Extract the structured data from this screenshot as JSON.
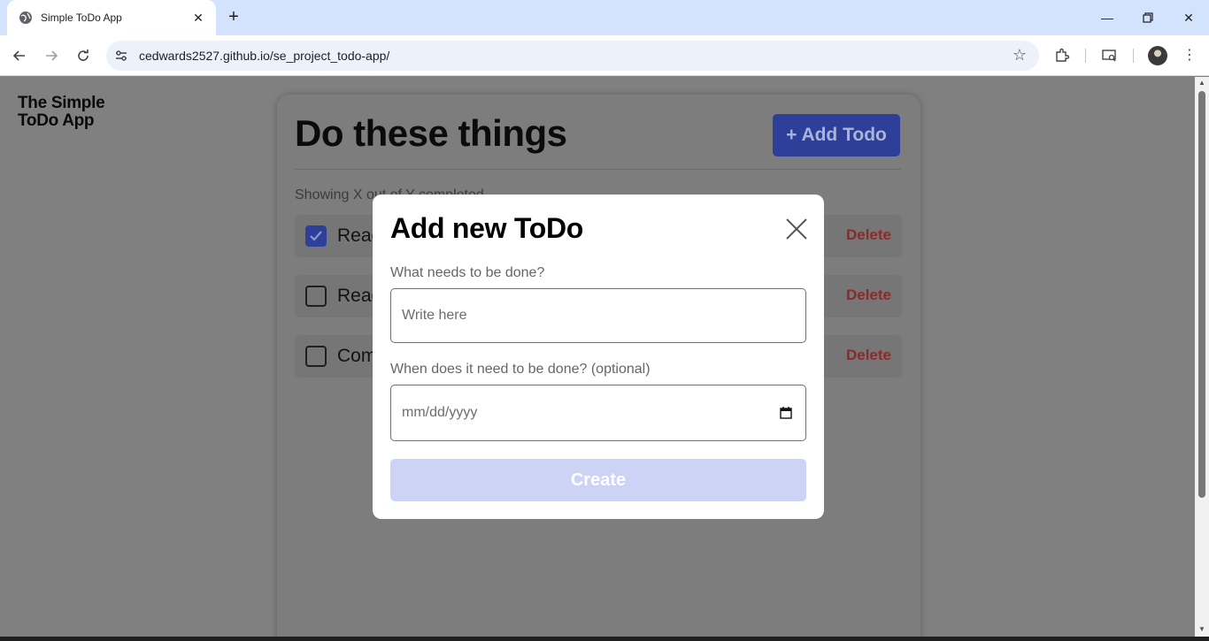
{
  "browser": {
    "tab_title": "Simple ToDo App",
    "url": "cedwards2527.github.io/se_project_todo-app/"
  },
  "page": {
    "brand": "The Simple ToDo App",
    "title": "Do these things",
    "add_button": "+ Add Todo",
    "summary": "Showing X out of Y completed",
    "todos": [
      {
        "text": "Read",
        "checked": true,
        "delete_label": "Delete"
      },
      {
        "text": "Read",
        "checked": false,
        "delete_label": "Delete"
      },
      {
        "text": "Com",
        "checked": false,
        "delete_label": "Delete"
      }
    ]
  },
  "modal": {
    "title": "Add new ToDo",
    "name_label": "What needs to be done?",
    "name_placeholder": "Write here",
    "date_label": "When does it need to be done? (optional)",
    "date_placeholder": "mm/dd/yyyy",
    "submit_label": "Create"
  },
  "colors": {
    "primary": "#4e63d6",
    "primary_disabled": "#ccd3f5",
    "danger": "#d34a4a",
    "overlay": "#808080"
  },
  "icons": [
    "globe-icon",
    "close-icon",
    "plus-icon",
    "back-arrow-icon",
    "forward-arrow-icon",
    "reload-icon",
    "tune-icon",
    "star-icon",
    "extensions-icon",
    "cast-icon",
    "menu-icon",
    "check-icon",
    "calendar-icon"
  ]
}
